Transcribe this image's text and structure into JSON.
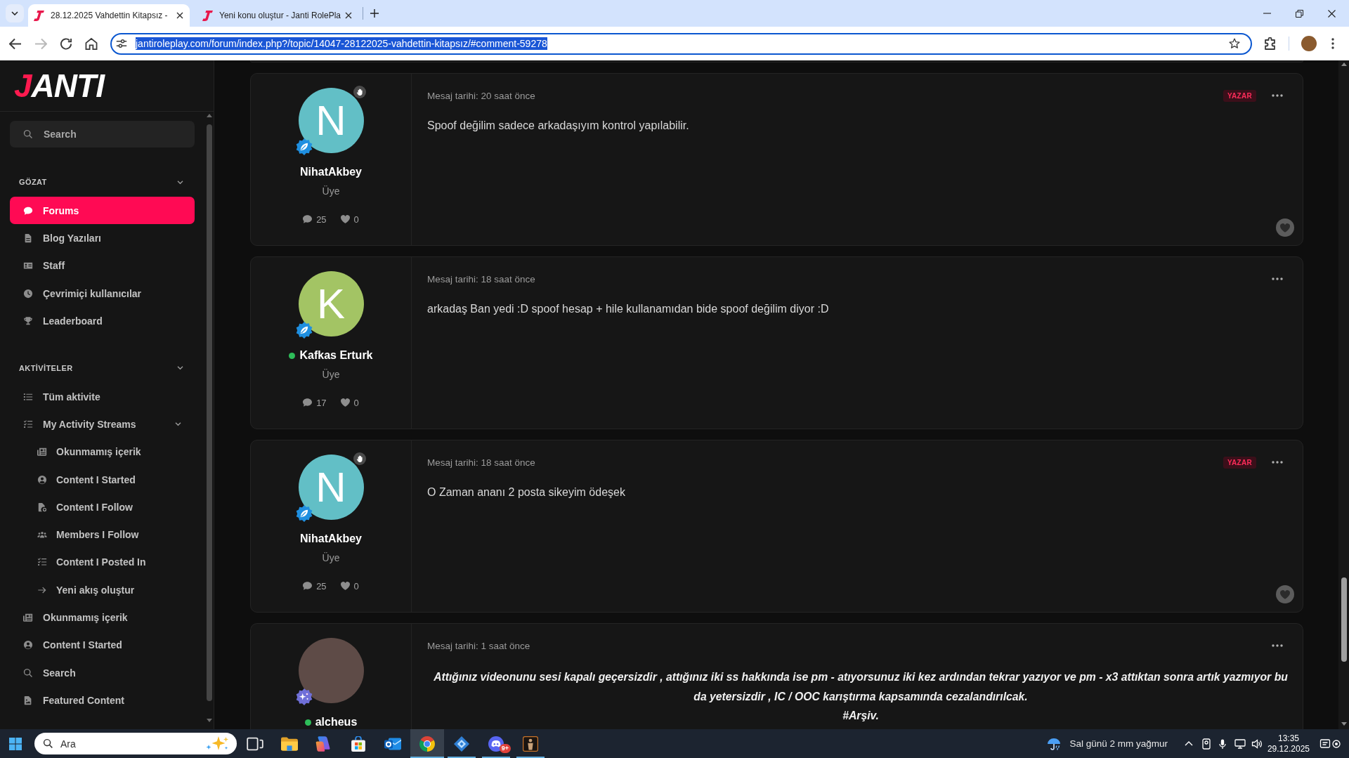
{
  "browser": {
    "tabs": [
      {
        "title": "28.12.2025 Vahdettin Kitapsız -",
        "selected": true
      },
      {
        "title": "Yeni konu oluştur - Janti RolePla",
        "selected": false
      }
    ],
    "forward_disabled": true,
    "address_bar": {
      "url": "jantiroleplay.com/forum/index.php?/topic/14047-28122025-vahdettin-kitapsız/#comment-59278",
      "selected": true
    }
  },
  "sidebar": {
    "logo": "JANTI",
    "search": {
      "placeholder": "Search"
    },
    "sections": [
      {
        "title": "GÖZAT",
        "expanded": true,
        "items": [
          {
            "label": "Forums",
            "selected": true
          },
          {
            "label": "Blog Yazıları",
            "selected": false
          },
          {
            "label": "Staff",
            "selected": false
          },
          {
            "label": "Çevrimiçi kullanıcılar",
            "selected": false
          },
          {
            "label": "Leaderboard",
            "selected": false
          }
        ]
      },
      {
        "title": "AKTİVİTELER",
        "expanded": true,
        "items": [
          {
            "label": "Tüm aktivite",
            "selected": false
          },
          {
            "label": "My Activity Streams",
            "selected": false,
            "expanded": true,
            "children": [
              {
                "label": "Okunmamış içerik",
                "selected": false
              },
              {
                "label": "Content I Started",
                "selected": false
              },
              {
                "label": "Content I Follow",
                "selected": false
              },
              {
                "label": "Members I Follow",
                "selected": false
              },
              {
                "label": "Content I Posted In",
                "selected": false
              },
              {
                "label": "Yeni akış oluştur",
                "selected": false
              }
            ]
          },
          {
            "label": "Okunmamış içerik",
            "selected": false
          },
          {
            "label": "Content I Started",
            "selected": false
          },
          {
            "label": "Search",
            "selected": false
          },
          {
            "label": "Featured Content",
            "selected": false
          }
        ]
      }
    ]
  },
  "posts": [
    {
      "kind": "plain",
      "author": "NihatAkbey",
      "online": false,
      "hand_badge": true,
      "avatar": {
        "kind": "letter",
        "letter": "N",
        "color": "#62bfc6"
      },
      "badge": {
        "kind": "leaf"
      },
      "rank": "Üye",
      "comments": "25",
      "reactions": "0",
      "date": "Mesaj tarihi: 20 saat önce",
      "author_tag": "YAZAR",
      "paragraphs": [
        "Spoof değilim sadece arkadaşıyım kontrol yapılabilir."
      ],
      "react_button": true
    },
    {
      "kind": "plain",
      "author": "Kafkas Erturk",
      "online": true,
      "hand_badge": false,
      "avatar": {
        "kind": "letter",
        "letter": "K",
        "color": "#a3c464"
      },
      "badge": {
        "kind": "leaf"
      },
      "rank": "Üye",
      "comments": "17",
      "reactions": "0",
      "date": "Mesaj tarihi: 18 saat önce",
      "paragraphs": [
        "arkadaş Ban yedi :D spoof hesap + hile kullanamıdan bide spoof değilim diyor :D"
      ],
      "react_button": false
    },
    {
      "kind": "plain",
      "author": "NihatAkbey",
      "online": false,
      "hand_badge": true,
      "avatar": {
        "kind": "letter",
        "letter": "N",
        "color": "#62bfc6"
      },
      "badge": {
        "kind": "leaf"
      },
      "rank": "Üye",
      "comments": "25",
      "reactions": "0",
      "date": "Mesaj tarihi: 18 saat önce",
      "author_tag": "YAZAR",
      "paragraphs": [
        "O Zaman ananı 2 posta sikeyim ödeşek"
      ],
      "react_button": true
    },
    {
      "kind": "emphasized",
      "author": "alcheus",
      "online": true,
      "hand_badge": false,
      "avatar": {
        "kind": "photo"
      },
      "badge": {
        "kind": "spark"
      },
      "date": "Mesaj tarihi: 1 saat önce",
      "paragraphs": [
        "Attığınız videonunu sesi kapalı geçersizdir , attığınız iki ss hakkında ise pm - atıyorsunuz iki kez ardından tekrar yazıyor ve pm - x3 attıktan sonra artık yazmıyor bu da yetersizdir , IC / OOC karıştırma kapsamında cezalandırılcak.",
        "#Arşiv."
      ]
    }
  ],
  "taskbar": {
    "search": {
      "placeholder": "Ara"
    },
    "apps": [
      {
        "selected": false,
        "running": false
      },
      {
        "selected": false,
        "running": false
      },
      {
        "selected": false,
        "running": false
      },
      {
        "selected": false,
        "running": false
      },
      {
        "selected": false,
        "running": false
      },
      {
        "selected": true,
        "running": true
      },
      {
        "selected": false,
        "running": true
      },
      {
        "selected": false,
        "running": true,
        "badge": "9+"
      },
      {
        "selected": false,
        "running": true
      }
    ],
    "weather": "Sal günü 2 mm yağmur",
    "clock": {
      "time": "13:35",
      "date": "29.12.2025"
    }
  }
}
